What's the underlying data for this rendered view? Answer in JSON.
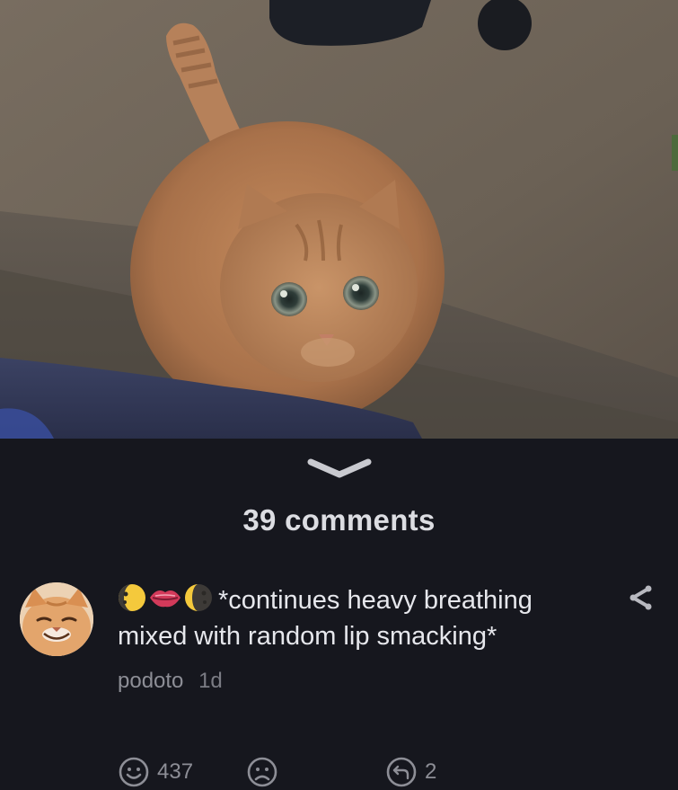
{
  "photo": {
    "subject": "orange-tabby-cat-photo"
  },
  "sheet": {
    "comments_count_label": "39 comments"
  },
  "comment": {
    "emojis": [
      "waning-moon-icon",
      "lips-icon",
      "waxing-moon-icon"
    ],
    "text": "*continues heavy breathing mixed with random lip smacking*",
    "author": "podoto",
    "age": "1d",
    "likes": "437",
    "replies": "2"
  },
  "colors": {
    "sheet_background": "#16171e",
    "text_primary": "#e6e7ec",
    "text_secondary": "#8d8e96"
  }
}
